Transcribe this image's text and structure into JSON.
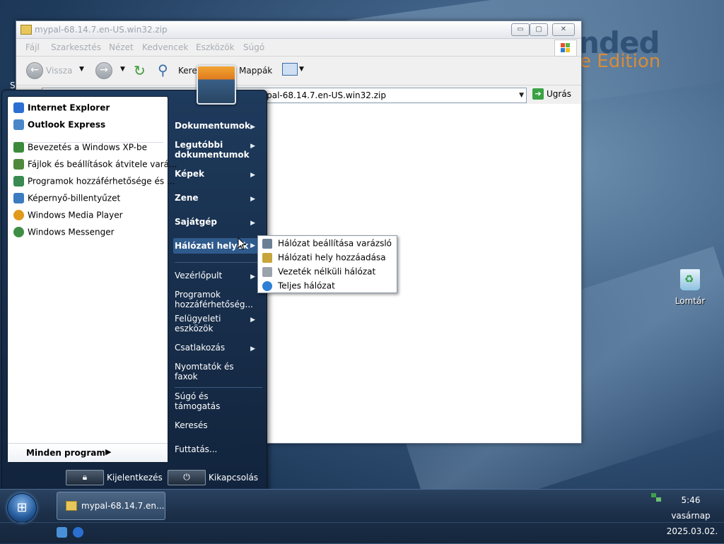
{
  "brand": {
    "line1": "nded",
    "line2": "e Edition"
  },
  "window": {
    "title": "mypal-68.14.7.en-US.win32.zip",
    "controls": {
      "minimize": "▭",
      "maximize": "▢",
      "close": "✕"
    },
    "menu": [
      "Fájl",
      "Szarkesztés",
      "Nézet",
      "Kedvencek",
      "Eszközök",
      "Súgó"
    ],
    "toolbar": {
      "back": "Vissza",
      "search": "Kere",
      "folders": "Mappák"
    },
    "address": {
      "value": "ypal-68.14.7.en-US.win32.zip",
      "go": "Ugrás"
    }
  },
  "start_menu": {
    "pinned": [
      {
        "label": "Internet Explorer",
        "color": "#2a6fd1"
      },
      {
        "label": "Outlook Express",
        "color": "#4b86c8"
      }
    ],
    "recent": [
      {
        "label": "Bevezetés a Windows XP-be",
        "color": "#3c8a3a"
      },
      {
        "label": "Fájlok és beállítások átvitele vará...",
        "color": "#4f8a3b"
      },
      {
        "label": "Programok hozzáférhetősége és ...",
        "color": "#3a8a52"
      },
      {
        "label": "Képernyő-billentyűzet",
        "color": "#3b7bc0"
      },
      {
        "label": "Windows Media Player",
        "color": "#e09a1c"
      },
      {
        "label": "Windows Messenger",
        "color": "#3d8e44"
      }
    ],
    "all_programs": "Minden program",
    "all_programs_arrow": "▶",
    "right": {
      "documents": "Dokumentumok",
      "recent_docs": "Legutóbbi dokumentumok",
      "pictures": "Képek",
      "music": "Zene",
      "my_computer": "Sajátgép",
      "network": "Hálózati helyek",
      "control_panel": "Vezérlőpult",
      "program_access": "Programok hozzáférhetőség...",
      "admin_tools": "Felügyeleti eszközök",
      "connect": "Csatlakozás",
      "printers": "Nyomtatók és faxok",
      "help": "Súgó és támogatás",
      "search": "Keresés",
      "run": "Futtatás..."
    },
    "logoff": "Kijelentkezés",
    "shutdown": "Kikapcsolás"
  },
  "network_submenu": [
    {
      "label": "Hálózat beállítása varázsló",
      "color": "#6d7f95"
    },
    {
      "label": "Hálózati hely hozzáadása",
      "color": "#c8a53a"
    },
    {
      "label": "Vezeték nélküli hálózat",
      "color": "#9aa3ad"
    },
    {
      "label": "Teljes hálózat",
      "color": "#2e7fd4"
    }
  ],
  "desktop": {
    "recycle_bin": "Lomtár",
    "peek_letter": "S"
  },
  "taskbar": {
    "task": "mypal-68.14.7.en...",
    "time": "5:46",
    "day": "vasárnap",
    "date": "2025.03.02."
  }
}
